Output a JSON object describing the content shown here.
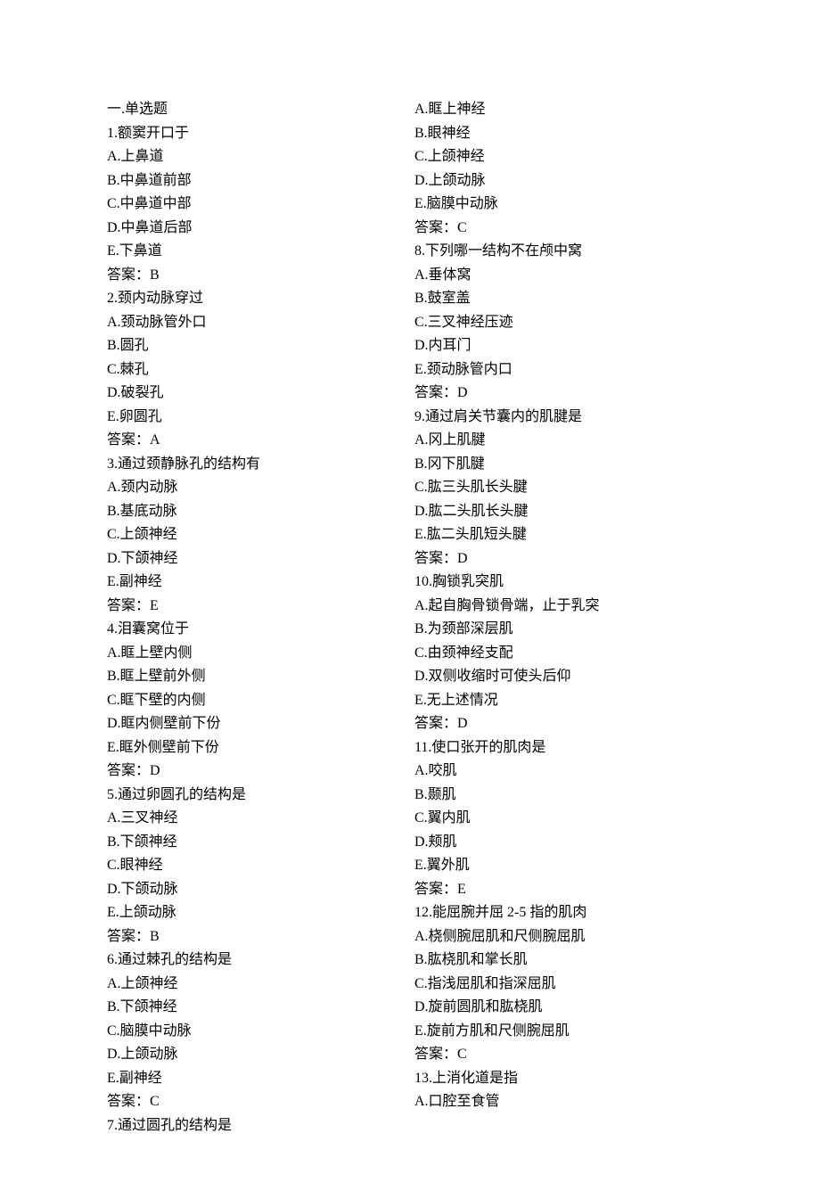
{
  "left": [
    "一.单选题",
    "1.额窦开口于",
    "A.上鼻道",
    "B.中鼻道前部",
    "C.中鼻道中部",
    "D.中鼻道后部",
    "E.下鼻道",
    "答案：B",
    "2.颈内动脉穿过",
    "A.颈动脉管外口",
    "B.圆孔",
    "C.棘孔",
    "D.破裂孔",
    "E.卵圆孔",
    "答案：A",
    "3.通过颈静脉孔的结构有",
    "A.颈内动脉",
    "B.基底动脉",
    "C.上颌神经",
    "D.下颌神经",
    "E.副神经",
    "答案：E",
    "4.泪囊窝位于",
    "A.眶上壁内侧",
    "B.眶上壁前外侧",
    "C.眶下壁的内侧",
    "D.眶内侧壁前下份",
    "E.眶外侧壁前下份",
    "答案：D",
    "5.通过卵圆孔的结构是",
    "A.三叉神经",
    "B.下颌神经",
    "C.眼神经",
    "D.下颌动脉",
    "E.上颌动脉",
    "答案：B",
    "6.通过棘孔的结构是",
    "A.上颌神经",
    "B.下颌神经",
    "C.脑膜中动脉",
    "D.上颌动脉",
    "E.副神经",
    "答案：C",
    "7.通过圆孔的结构是"
  ],
  "right": [
    "A.眶上神经",
    "B.眼神经",
    "C.上颌神经",
    "D.上颌动脉",
    "E.脑膜中动脉",
    "答案：C",
    "8.下列哪一结构不在颅中窝",
    "A.垂体窝",
    "B.鼓室盖",
    "C.三叉神经压迹",
    "D.内耳门",
    "E.颈动脉管内口",
    "答案：D",
    "9.通过肩关节囊内的肌腱是",
    "A.冈上肌腱",
    "B.冈下肌腱",
    "C.肱三头肌长头腱",
    "D.肱二头肌长头腱",
    "E.肱二头肌短头腱",
    "答案：D",
    "10.胸锁乳突肌",
    "A.起自胸骨锁骨端，止于乳突",
    "B.为颈部深层肌",
    "C.由颈神经支配",
    "D.双侧收缩时可使头后仰",
    "E.无上述情况",
    "答案：D",
    "11.使口张开的肌肉是",
    "A.咬肌",
    "B.颞肌",
    "C.翼内肌",
    "D.颊肌",
    "E.翼外肌",
    "答案：E",
    "12.能屈腕并屈 2-5 指的肌肉",
    "A.桡侧腕屈肌和尺侧腕屈肌",
    "B.肱桡肌和掌长肌",
    "C.指浅屈肌和指深屈肌",
    "D.旋前圆肌和肱桡肌",
    "E.旋前方肌和尺侧腕屈肌",
    "答案：C",
    "13.上消化道是指",
    "A.口腔至食管"
  ]
}
